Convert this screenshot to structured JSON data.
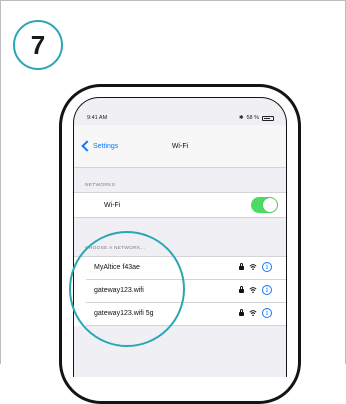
{
  "step": {
    "number": "7"
  },
  "status_bar": {
    "time": "9:41 AM",
    "battery": "58 %"
  },
  "nav": {
    "back_label": "Settings",
    "title": "Wi-Fi"
  },
  "sections": {
    "networks_label": "NETWORKS",
    "choose_label": "CHOOSE A NETWORK..."
  },
  "wifi_toggle": {
    "label": "Wi-Fi",
    "state": "on"
  },
  "networks": [
    {
      "name": "MyAltice f43ae"
    },
    {
      "name": "gateway123.wifi"
    },
    {
      "name": "gateway123.wifi 5g"
    }
  ],
  "colors": {
    "accent": "#2aa6b4",
    "ios_blue": "#0a7aff",
    "toggle_on": "#4cd964"
  },
  "icons": {
    "lock": "lock-icon",
    "wifi": "wifi-icon",
    "info": "info-icon"
  }
}
